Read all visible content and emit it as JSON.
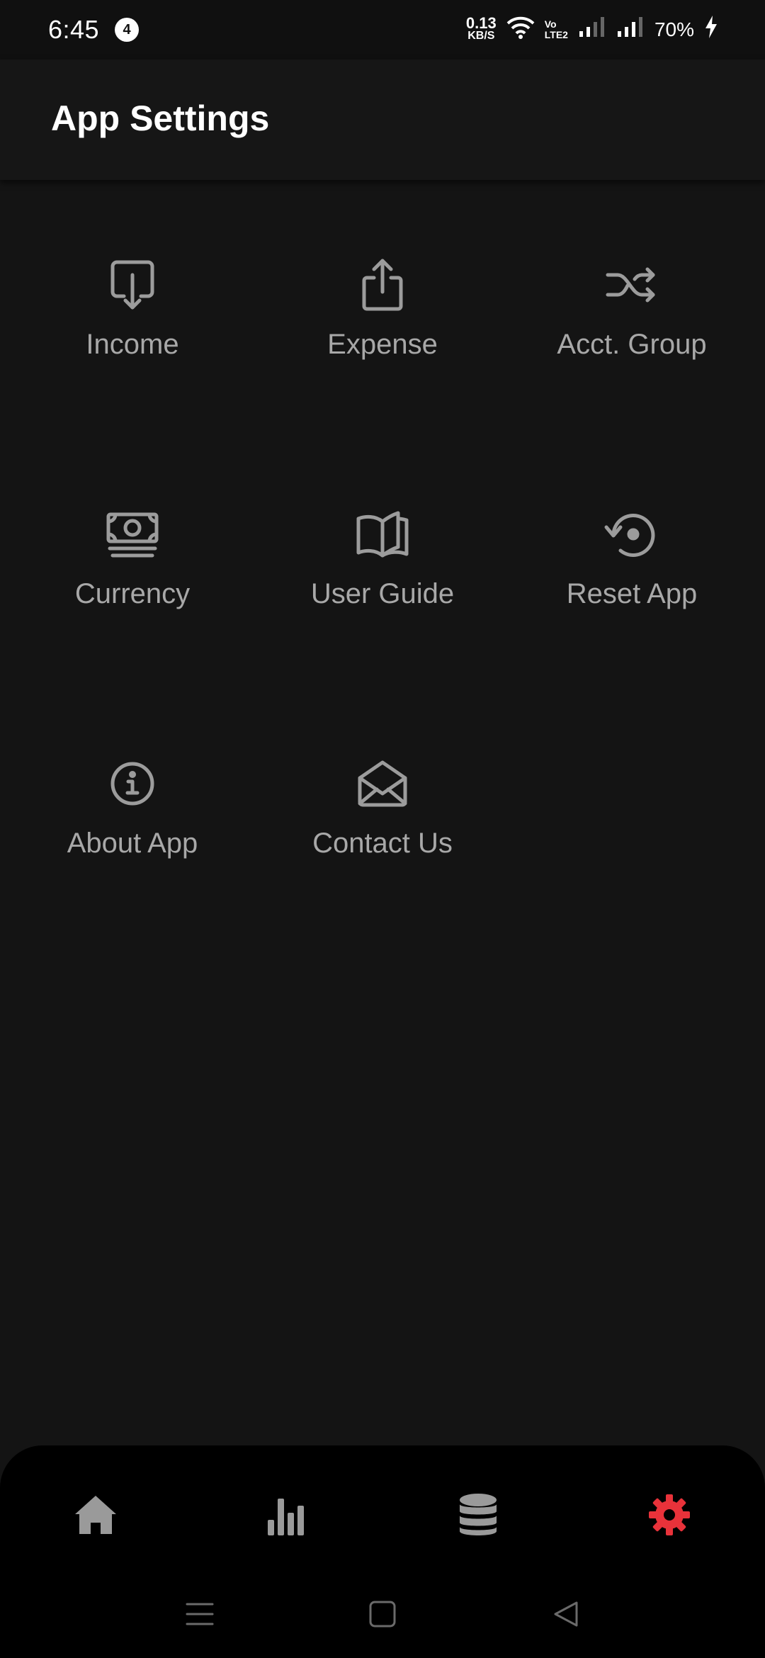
{
  "status_bar": {
    "time": "6:45",
    "notification_count": "4",
    "net_speed_value": "0.13",
    "net_speed_unit": "KB/S",
    "volte_line1": "Vo",
    "volte_line2": "LTE2",
    "battery": "70%"
  },
  "app_bar": {
    "title": "App Settings"
  },
  "settings": [
    {
      "label": "Income",
      "icon": "download-tray-icon"
    },
    {
      "label": "Expense",
      "icon": "share-upload-icon"
    },
    {
      "label": "Acct. Group",
      "icon": "shuffle-icon"
    },
    {
      "label": "Currency",
      "icon": "money-bill-icon"
    },
    {
      "label": "User Guide",
      "icon": "open-book-icon"
    },
    {
      "label": "Reset App",
      "icon": "reset-icon"
    },
    {
      "label": "About App",
      "icon": "info-icon"
    },
    {
      "label": "Contact Us",
      "icon": "open-envelope-icon"
    }
  ],
  "bottom_nav": {
    "items": [
      {
        "icon": "home-icon",
        "active": false
      },
      {
        "icon": "bar-chart-icon",
        "active": false
      },
      {
        "icon": "database-icon",
        "active": false
      },
      {
        "icon": "gear-icon",
        "active": true
      }
    ],
    "active_color": "#e8323a",
    "inactive_color": "#9a9a9a"
  },
  "colors": {
    "background": "#141414",
    "label": "#a8a8a8",
    "icon": "#9c9c9c"
  }
}
